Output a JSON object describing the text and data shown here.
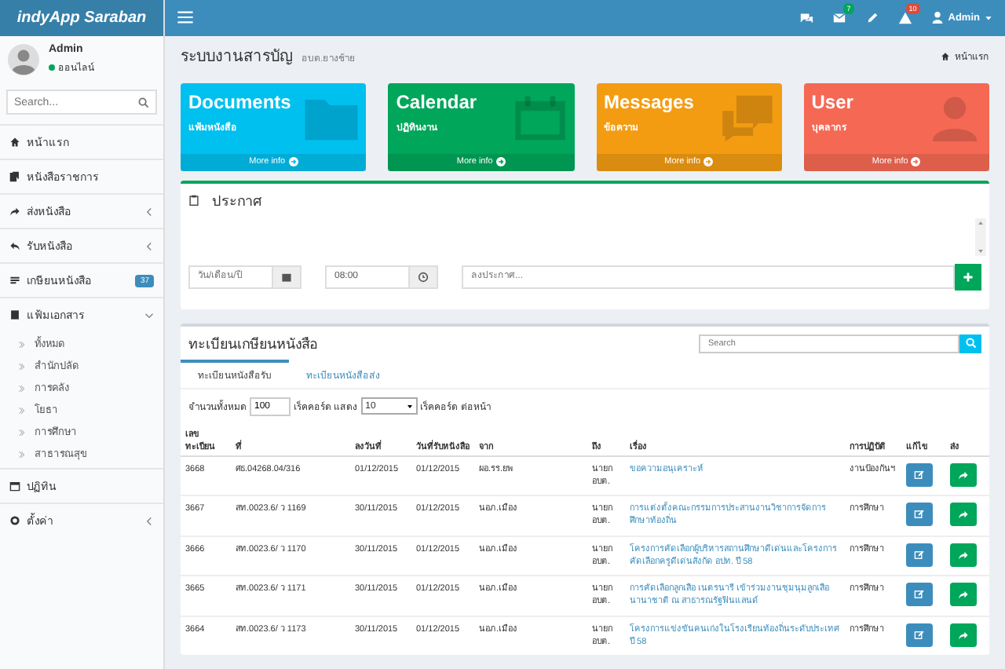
{
  "brand": "indyApp Saraban",
  "header": {
    "badges": [
      {
        "kind": "chat"
      },
      {
        "kind": "mail",
        "count": "7",
        "color": "#00a65a"
      },
      {
        "kind": "pencil"
      },
      {
        "kind": "warning",
        "count": "10",
        "color": "#dd4b39"
      }
    ],
    "user": "Admin"
  },
  "user_panel": {
    "name": "Admin",
    "status": "ออนไลน์"
  },
  "sidebar": {
    "search": {
      "placeholder": "Search..."
    },
    "items": [
      {
        "label": "หน้าแรก"
      },
      {
        "label": "หนังสือราชการ"
      },
      {
        "label": "ส่งหนังสือ",
        "expanded": false
      },
      {
        "label": "รับหนังสือ",
        "expanded": false
      },
      {
        "label": "เกษียนหนังสือ",
        "badge": "37"
      },
      {
        "label": "แฟ้มเอกสาร",
        "expanded": true,
        "children": [
          {
            "label": "ทั้งหมด"
          },
          {
            "label": "สำนักปลัด"
          },
          {
            "label": "การคลัง"
          },
          {
            "label": "โยธา"
          },
          {
            "label": "การศึกษา"
          },
          {
            "label": "สาธารณสุข"
          }
        ]
      },
      {
        "label": "ปฏิทิน"
      },
      {
        "label": "ตั้งค่า",
        "expanded": false
      }
    ]
  },
  "page": {
    "title": "ระบบงานสารบัญ",
    "subtitle": "อบต.ยางช้าย",
    "breadcrumb": "หน้าแรก"
  },
  "tiles": [
    {
      "title": "Documents",
      "subtitle": "แฟ้มหนังสือ",
      "link": "More info",
      "color": "#00c0ef",
      "kind": "folder"
    },
    {
      "title": "Calendar",
      "subtitle": "ปฏิทินงาน",
      "link": "More info",
      "color": "#00a65a",
      "kind": "calendar"
    },
    {
      "title": "Messages",
      "subtitle": "ข้อความ",
      "link": "More info",
      "color": "#f39c12",
      "kind": "chat"
    },
    {
      "title": "User",
      "subtitle": "บุคลากร",
      "link": "More info",
      "color": "#f56954",
      "kind": "user"
    }
  ],
  "announcement": {
    "title": "ประกาศ",
    "date": {
      "placeholder": "วัน/เดือน/ปี"
    },
    "time": {
      "value": "08:00"
    },
    "message": {
      "placeholder": "ลงประกาศ..."
    }
  },
  "register": {
    "title": "ทะเบียนเกษียนหนังสือ",
    "search": {
      "placeholder": "Search"
    },
    "tabs": [
      {
        "label": "ทะเบียนหนังสือรับ",
        "selected": true
      },
      {
        "label": "ทะเบียนหนังสือส่ง",
        "selected": false
      }
    ],
    "summary": {
      "total_label": "จำนวนทั้งหมด",
      "total": "100",
      "show_label": "เร็คคอร์ด แสดง",
      "page_size": "10",
      "per_page_label": "เร็คคอร์ด ต่อหน้า"
    },
    "columns": [
      "เลขทะเบียน",
      "ที่",
      "ลงวันที่",
      "วันที่รับหนังสือ",
      "จาก",
      "ถึง",
      "เรื่อง",
      "การปฏิบัติ",
      "แก้ไข",
      "ส่ง"
    ],
    "rows": [
      {
        "no": "3668",
        "ref": "ศธ.04268.04/316",
        "date": "01/12/2015",
        "received": "01/12/2015",
        "from": "ผอ.รร.ยพ",
        "to": "นายก อบต.",
        "subject": "ขอความอนุเคราะห์",
        "action": "งานป้องกันฯ"
      },
      {
        "no": "3667",
        "ref": "สท.0023.6/ ว 1169",
        "date": "30/11/2015",
        "received": "01/12/2015",
        "from": "นอภ.เมือง",
        "to": "นายก อบต.",
        "subject": "การแต่งตั้งคณะกรรมการประสานงานวิชาการจัดการศึกษาท้องถิ่น",
        "action": "การศึกษา"
      },
      {
        "no": "3666",
        "ref": "สท.0023.6/ ว 1170",
        "date": "30/11/2015",
        "received": "01/12/2015",
        "from": "นอภ.เมือง",
        "to": "นายก อบต.",
        "subject": "โครงการคัดเลือกผู้บริหารสถานศึกษาดีเด่นและโครงการคัดเลือกครูดีเด่นสังกัด อปท. ปี 58",
        "action": "การศึกษา"
      },
      {
        "no": "3665",
        "ref": "สท.0023.6/ ว 1171",
        "date": "30/11/2015",
        "received": "01/12/2015",
        "from": "นอภ.เมือง",
        "to": "นายก อบต.",
        "subject": "การคัดเลือกลูกเสือ เนตรนารี เข้าร่วมงานชุมนุมลูกเสือนานาชาติ ณ สาธารณรัฐฟินแลนด์",
        "action": "การศึกษา"
      },
      {
        "no": "3664",
        "ref": "สท.0023.6/ ว 1173",
        "date": "30/11/2015",
        "received": "01/12/2015",
        "from": "นอภ.เมือง",
        "to": "นายก อบต.",
        "subject": "โครงการแข่งขันคนเก่งในโรงเรียนท้องถิ่นระดับประเทศ ปี 58",
        "action": "การศึกษา"
      }
    ]
  }
}
